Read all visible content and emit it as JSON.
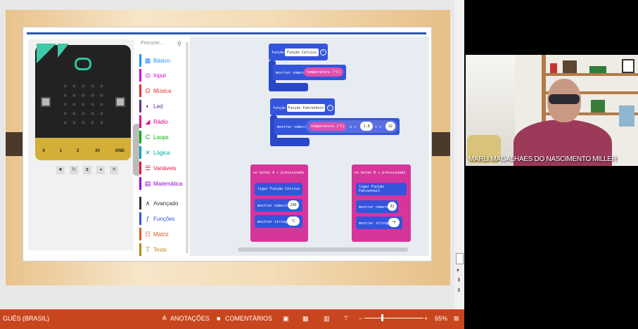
{
  "makecode": {
    "toolbox": {
      "search_placeholder": "Procurar...",
      "categories": [
        {
          "label": "Básico",
          "color": "#1e90ff",
          "icon": "grid-icon"
        },
        {
          "label": "Input",
          "color": "#d400d4",
          "icon": "target-icon"
        },
        {
          "label": "Música",
          "color": "#e63022",
          "icon": "headphones-icon"
        },
        {
          "label": "Led",
          "color": "#5c2d91",
          "icon": "toggle-icon"
        },
        {
          "label": "Rádio",
          "color": "#e3008c",
          "icon": "signal-icon"
        },
        {
          "label": "Loops",
          "color": "#00aa00",
          "icon": "loop-icon"
        },
        {
          "label": "Lógica",
          "color": "#00a4a6",
          "icon": "shuffle-icon"
        },
        {
          "label": "Variáveis",
          "color": "#dc143c",
          "icon": "list-icon"
        },
        {
          "label": "Matemática",
          "color": "#9400d3",
          "icon": "calculator-icon"
        },
        {
          "label": "Avançado",
          "color": "#333333",
          "icon": "chevron-up-icon"
        },
        {
          "label": "Funções",
          "color": "#3455db",
          "icon": "function-icon"
        },
        {
          "label": "Matriz",
          "color": "#e65722",
          "icon": "array-icon"
        },
        {
          "label": "Texto",
          "color": "#b8860b",
          "icon": "text-icon"
        }
      ]
    },
    "simulator": {
      "pins": [
        "0",
        "1",
        "2",
        "3V",
        "GND"
      ]
    },
    "blocks": {
      "fn_celsius": {
        "keyword": "função",
        "name": "Função Celsius",
        "stmt": "mostrar número",
        "var": "temperatura (°C)"
      },
      "fn_fahrenheit": {
        "keyword": "função",
        "name": "Função Fahrenheit",
        "stmt": "mostrar número",
        "var": "temperatura (°C)",
        "op1": "x ▾",
        "num1": "1.8",
        "op2": "+ ▾",
        "num2": "32"
      },
      "btn_a": {
        "header": "no botão  A ▾  pressionado",
        "call": "ligar Função Celsius",
        "show_num": "mostrar número",
        "num": "200",
        "show_str": "mostrar string",
        "str": "°C"
      },
      "btn_b": {
        "header": "no botão  B ▾  pressionado",
        "call": "ligar Função Fahrenheit",
        "show_num": "mostrar número",
        "num": "32",
        "show_str": "mostrar string",
        "str": "°F"
      }
    }
  },
  "statusbar": {
    "language": "GUÊS (BRASIL)",
    "notes": "ANOTAÇÕES",
    "comments": "COMENTÁRIOS",
    "zoom": "65%",
    "zoom_level": 0.65
  },
  "webcam": {
    "participant_name": "MARLI MAGALHAES DO NASCIMENTO MILLER"
  }
}
